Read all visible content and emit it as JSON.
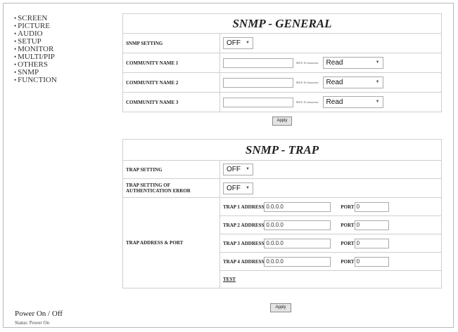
{
  "sidebar": {
    "items": [
      {
        "label": "SCREEN"
      },
      {
        "label": "PICTURE"
      },
      {
        "label": "AUDIO"
      },
      {
        "label": "SETUP"
      },
      {
        "label": "MONITOR"
      },
      {
        "label": "MULTI/PIP"
      },
      {
        "label": "OTHERS"
      },
      {
        "label": "SNMP"
      },
      {
        "label": "FUNCTION"
      }
    ],
    "power": "Power On / Off",
    "status": "Status: Power On"
  },
  "general": {
    "title": "SNMP - GENERAL",
    "snmp_setting_label": "SNMP SETTING",
    "snmp_setting_value": "OFF",
    "communities": [
      {
        "label": "COMMUNITY NAME 1",
        "value": "",
        "hint": "MAX 16 characters",
        "access": "Read"
      },
      {
        "label": "COMMUNITY NAME 2",
        "value": "",
        "hint": "MAX 16 characters",
        "access": "Read"
      },
      {
        "label": "COMMUNITY NAME 3",
        "value": "",
        "hint": "MAX 16 characters",
        "access": "Read"
      }
    ],
    "apply_label": "Apply"
  },
  "trap": {
    "title": "SNMP - TRAP",
    "trap_setting_label": "TRAP SETTING",
    "trap_setting_value": "OFF",
    "auth_label_line1": "TRAP SETTING OF",
    "auth_label_line2": "AUTHENTICATION ERROR",
    "auth_value": "OFF",
    "address_port_label": "TRAP ADDRESS & PORT",
    "address_caption": "ADDRESS",
    "port_caption": "PORT",
    "traps": [
      {
        "label": "TRAP 1",
        "address": "0.0.0.0",
        "port": "0"
      },
      {
        "label": "TRAP 2",
        "address": "0.0.0.0",
        "port": "0"
      },
      {
        "label": "TRAP 3",
        "address": "0.0.0.0",
        "port": "0"
      },
      {
        "label": "TRAP 4",
        "address": "0.0.0.0",
        "port": "0"
      }
    ],
    "test_label": "TEST",
    "apply_label": "Apply"
  },
  "icons": {
    "dropdown": "caret-down-icon",
    "bullet": "bullet-icon"
  }
}
